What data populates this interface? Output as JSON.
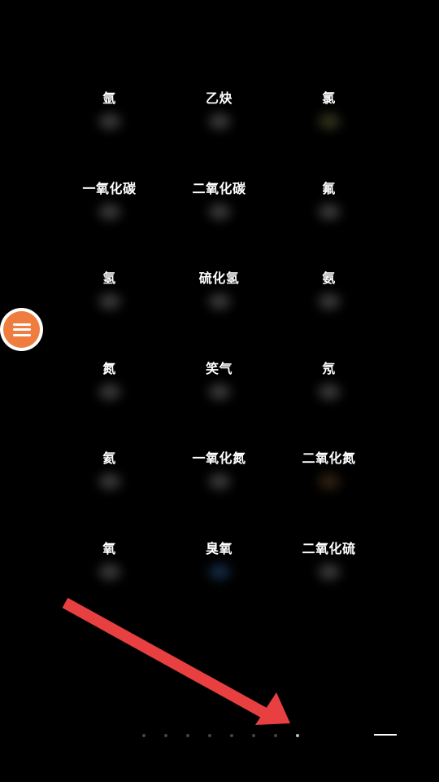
{
  "gases": [
    {
      "label": "氩",
      "color": "smoke"
    },
    {
      "label": "乙炔",
      "color": "smoke"
    },
    {
      "label": "氯",
      "color": "yellow"
    },
    {
      "label": "一氧化碳",
      "color": "smoke"
    },
    {
      "label": "二氧化碳",
      "color": "smoke"
    },
    {
      "label": "氟",
      "color": "smoke"
    },
    {
      "label": "氢",
      "color": "smoke"
    },
    {
      "label": "硫化氢",
      "color": "smoke"
    },
    {
      "label": "氨",
      "color": "smoke"
    },
    {
      "label": "氮",
      "color": "smoke"
    },
    {
      "label": "笑气",
      "color": "smoke"
    },
    {
      "label": "氖",
      "color": "smoke"
    },
    {
      "label": "氦",
      "color": "smoke"
    },
    {
      "label": "一氧化氮",
      "color": "smoke"
    },
    {
      "label": "二氧化氮",
      "color": "brown"
    },
    {
      "label": "氧",
      "color": "smoke"
    },
    {
      "label": "臭氧",
      "color": "blue"
    },
    {
      "label": "二氧化硫",
      "color": "smoke"
    }
  ],
  "menu_button": {
    "icon": "hamburger-menu-icon",
    "color": "#F07D40"
  },
  "annotation_arrow": {
    "icon": "red-arrow-icon",
    "color": "#E84040"
  },
  "pagination": {
    "total": 8,
    "active_index": 7
  },
  "home_indicator": {
    "icon": "home-bar-icon"
  }
}
